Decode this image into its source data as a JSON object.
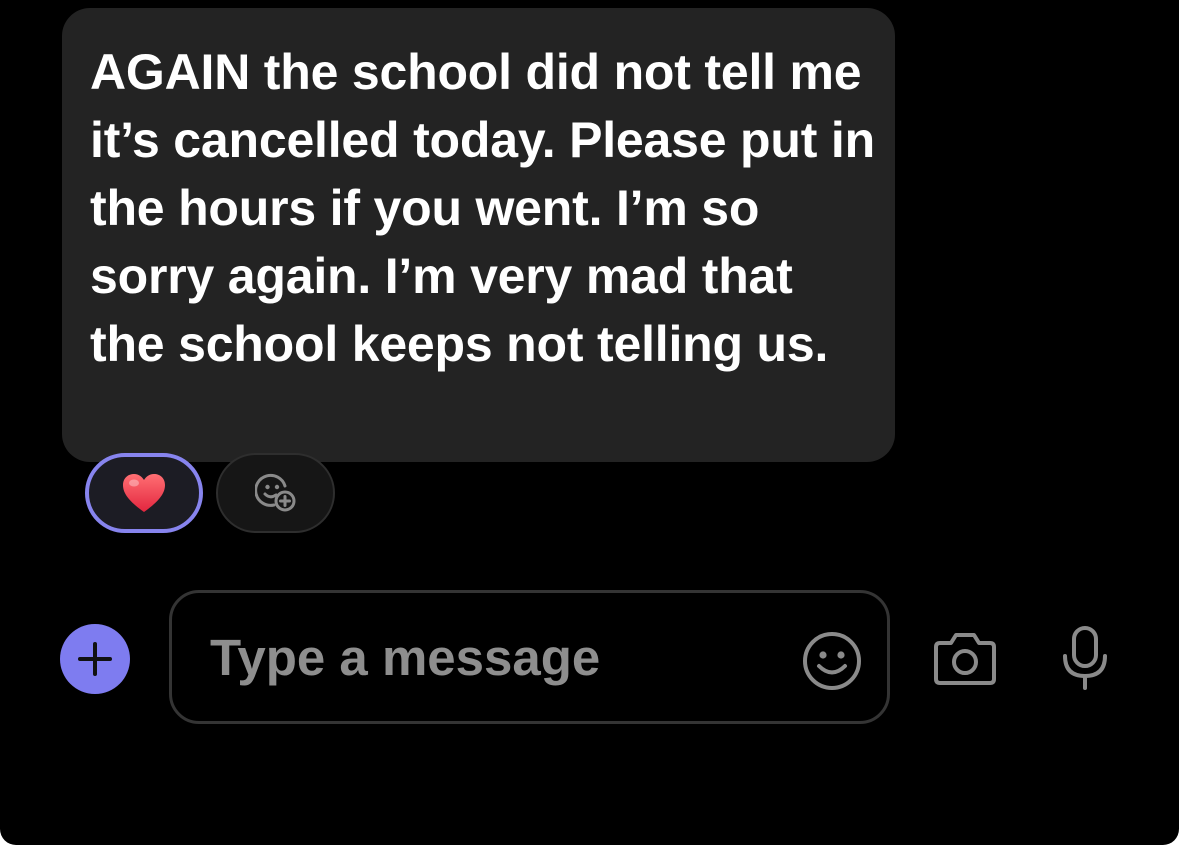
{
  "message": {
    "text": "AGAIN the school did not tell me it’s cancelled today. Please put in the hours if you went. I’m so sorry again. I’m very mad that the school keeps not telling us."
  },
  "reactions": {
    "active": {
      "icon": "heart-icon",
      "emoji": "❤️"
    },
    "add": {
      "icon": "add-reaction-icon"
    }
  },
  "composer": {
    "plus_icon": "plus-icon",
    "placeholder": "Type a message",
    "value": "",
    "emoji_icon": "emoji-icon",
    "camera_icon": "camera-icon",
    "mic_icon": "microphone-icon"
  },
  "colors": {
    "background": "#000000",
    "bubble": "#232323",
    "accent": "#7e7cf0",
    "reaction_border": "#8784ee",
    "placeholder": "#8e8e8e",
    "icon": "#8a8a8a"
  }
}
